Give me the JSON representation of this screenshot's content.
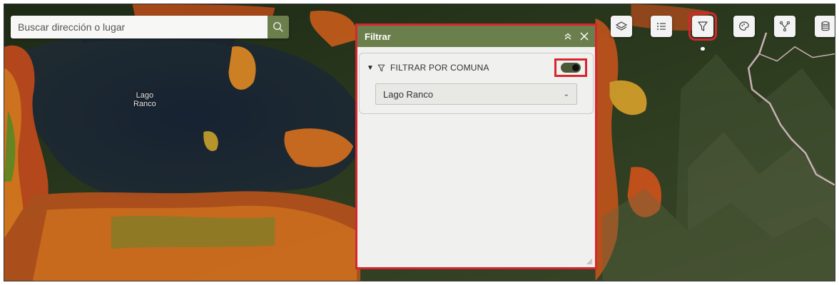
{
  "search": {
    "placeholder": "Buscar dirección o lugar",
    "button_icon": "search-icon"
  },
  "map": {
    "labels": [
      {
        "text": "Lago\nRanco"
      }
    ]
  },
  "toolbar": {
    "tools": [
      {
        "name": "layers-tool-button",
        "icon": "layers-icon"
      },
      {
        "name": "legend-tool-button",
        "icon": "list-icon"
      },
      {
        "name": "filter-tool-button",
        "icon": "filter-icon",
        "active": true
      },
      {
        "name": "palette-tool-button",
        "icon": "palette-icon"
      },
      {
        "name": "network-tool-button",
        "icon": "network-icon"
      },
      {
        "name": "database-tool-button",
        "icon": "database-icon"
      }
    ]
  },
  "filter_panel": {
    "title": "Filtrar",
    "section_label": "FILTRAR POR COMUNA",
    "toggle_on": true,
    "select_value": "Lago Ranco"
  },
  "colors": {
    "header": "#6b7f4c",
    "highlight": "#d7262e",
    "panel_bg": "#f0f0ef"
  }
}
